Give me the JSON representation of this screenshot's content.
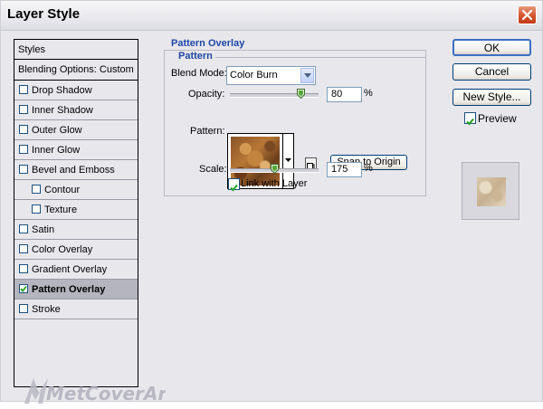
{
  "window": {
    "title": "Layer Style"
  },
  "styles_panel": {
    "header": "Styles",
    "blending_options": "Blending Options: Custom",
    "items": [
      {
        "label": "Drop Shadow",
        "checked": false,
        "indent": 0
      },
      {
        "label": "Inner Shadow",
        "checked": false,
        "indent": 0
      },
      {
        "label": "Outer Glow",
        "checked": false,
        "indent": 0
      },
      {
        "label": "Inner Glow",
        "checked": false,
        "indent": 0
      },
      {
        "label": "Bevel and Emboss",
        "checked": false,
        "indent": 0
      },
      {
        "label": "Contour",
        "checked": false,
        "indent": 1
      },
      {
        "label": "Texture",
        "checked": false,
        "indent": 1
      },
      {
        "label": "Satin",
        "checked": false,
        "indent": 0
      },
      {
        "label": "Color Overlay",
        "checked": false,
        "indent": 0
      },
      {
        "label": "Gradient Overlay",
        "checked": false,
        "indent": 0
      },
      {
        "label": "Pattern Overlay",
        "checked": true,
        "indent": 0,
        "selected": true
      },
      {
        "label": "Stroke",
        "checked": false,
        "indent": 0
      }
    ]
  },
  "pattern_overlay": {
    "title": "Pattern Overlay",
    "subtitle": "Pattern",
    "blend_mode_label": "Blend Mode:",
    "blend_mode_value": "Color Burn",
    "opacity_label": "Opacity:",
    "opacity_value": "80",
    "opacity_unit": "%",
    "opacity_fraction": 0.8,
    "pattern_label": "Pattern:",
    "snap_button": "Snap to Origin",
    "scale_label": "Scale:",
    "scale_value": "175",
    "scale_unit": "%",
    "scale_fraction": 0.5,
    "link_label": "Link with Layer",
    "link_checked": true
  },
  "buttons": {
    "ok": "OK",
    "cancel": "Cancel",
    "new_style": "New Style..."
  },
  "preview": {
    "label": "Preview",
    "checked": true
  },
  "watermark": {
    "text": "MetCoverArt"
  },
  "colors": {
    "accent": "#1e47a6",
    "selected_row": "#b5b5bf",
    "close": "#d4532e"
  },
  "icons": {
    "close": "close-icon",
    "dropdown": "chevron-down-icon",
    "check": "check-icon"
  }
}
